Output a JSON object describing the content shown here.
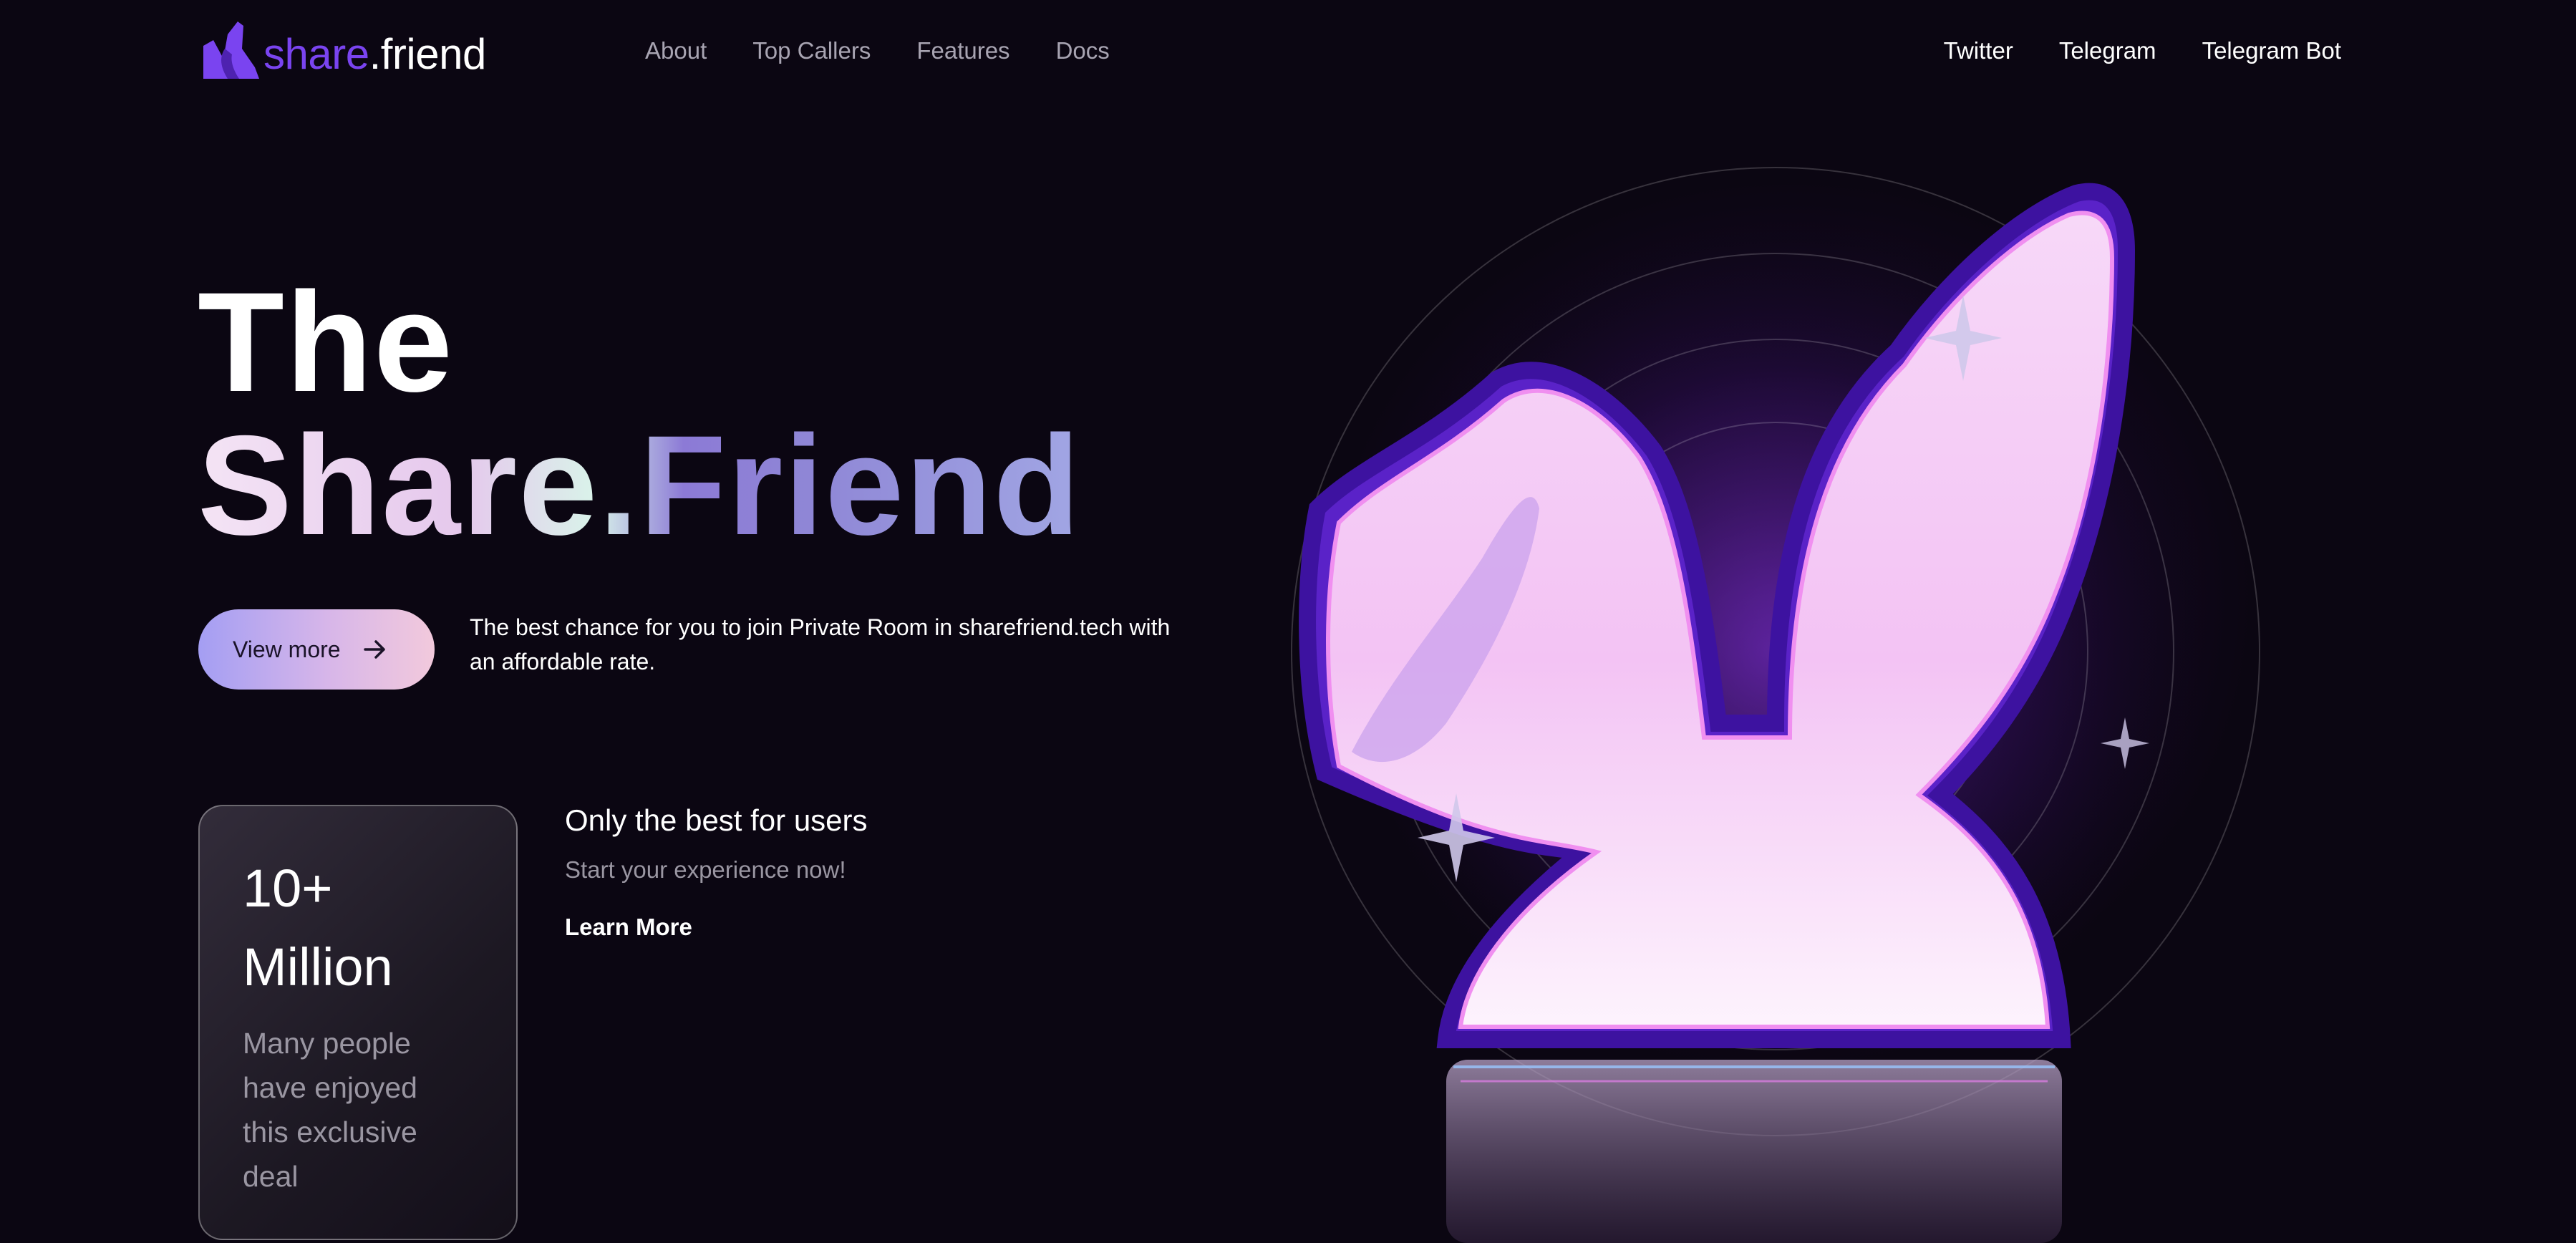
{
  "header": {
    "logo": {
      "share": "share",
      "friend": ".friend",
      "icon": "bunny-ears-icon"
    },
    "nav": [
      {
        "label": "About"
      },
      {
        "label": "Top Callers"
      },
      {
        "label": "Features"
      },
      {
        "label": "Docs"
      }
    ],
    "social": [
      {
        "label": "Twitter"
      },
      {
        "label": "Telegram"
      },
      {
        "label": "Telegram Bot"
      }
    ]
  },
  "hero": {
    "title_line1": "The",
    "title_line2": "Share.Friend",
    "cta_label": "View more",
    "cta_icon": "arrow-right-icon",
    "description": "The best chance for you to join Private Room in sharefriend.tech with an affordable rate."
  },
  "stat": {
    "value": "10+ Million",
    "description": "Many people have enjoyed this exclusive deal"
  },
  "feature": {
    "title": "Only the best for users",
    "subtitle": "Start your experience now!",
    "link": "Learn More"
  },
  "colors": {
    "background": "#0b0612",
    "brand_purple": "#7a44f0",
    "muted_text": "#a8a4b2",
    "bunny_pink": "#f3c6f5",
    "bunny_glow": "#6a2ad8"
  }
}
